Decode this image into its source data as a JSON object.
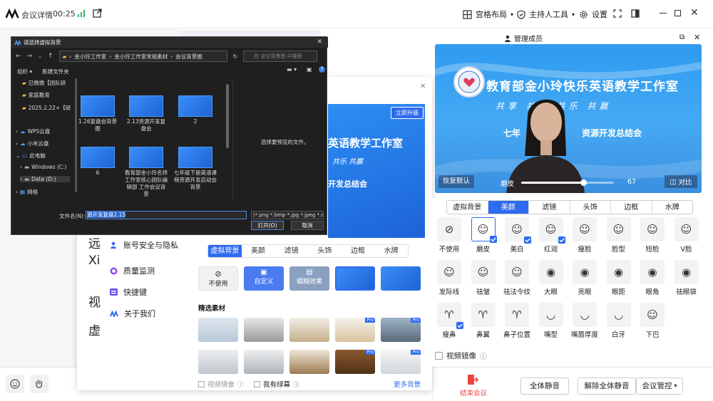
{
  "topbar": {
    "title": "会议详情",
    "timer": "00:25",
    "grid_layout": "宫格布局",
    "host_tools": "主持人工具",
    "settings": "设置"
  },
  "settings_dialog": {
    "nav": [
      {
        "label": "账号安全与隐私"
      },
      {
        "label": "质量监测"
      },
      {
        "label": "快捷键"
      },
      {
        "label": "关于我们"
      }
    ],
    "left_partial": [
      "远",
      "Xi",
      "视",
      "虚"
    ],
    "tabs": [
      "虚拟背景",
      "美颜",
      "滤镜",
      "头饰",
      "边框",
      "水牌"
    ],
    "active_tab": "虚拟背景",
    "options": {
      "none": "不使用",
      "custom": "自定义",
      "blur": "模糊效果"
    },
    "featured_label": "精选素材",
    "pro_badge": "Pro",
    "mirror_label": "视频镜像",
    "greenscreen_label": "我有绿幕",
    "more_bg": "更多背景",
    "preview_upgrade": "立即升级",
    "preview_title": "英语教学工作室",
    "preview_slogan": "共乐 共赢",
    "preview_subtitle": "开发总结会"
  },
  "file_dialog": {
    "title": "请选择虚拟背景",
    "path": [
      "金小玲工作室",
      "金小玲工作室常规素材",
      "会议背景图"
    ],
    "search_placeholder": "在 会议背景图 中搜索",
    "organize": "组织",
    "new_folder": "新建文件夹",
    "sidebar": [
      {
        "label": "已微微【团队研"
      },
      {
        "label": "家庭教育"
      },
      {
        "label": "2025.2.22+【研"
      },
      {
        "label": "WPS云盘"
      },
      {
        "label": "小米云盘"
      },
      {
        "label": "此电脑"
      },
      {
        "label": "Windows (C:)"
      },
      {
        "label": "Data (D:)"
      },
      {
        "label": "网络"
      }
    ],
    "files": [
      {
        "name": "1.26复盘会背景图"
      },
      {
        "name": "2.13资源开发复盘会"
      },
      {
        "name": "2"
      },
      {
        "name": "6"
      },
      {
        "name": "教育部金小玲名师工作室核心团队编辑部 工作会议背景"
      },
      {
        "name": "七年级下册英语课程资源开发启动会背景"
      }
    ],
    "preview_text": "选择要预览的文件。",
    "filename_label": "文件名(N):",
    "filename_value": "源开发复盘2.15",
    "filetype": "(*.png *.bmp *.jpg *.jpeg *.mc",
    "open_btn": "打开(O)",
    "cancel_btn": "取消"
  },
  "video": {
    "banner_title": "教育部金小玲快乐英语教学工作室",
    "slogan": "共享 共育 共乐 共赢",
    "subtitle_left": "七年",
    "subtitle_right": "资源开发总结会",
    "restore_btn": "恢复默认",
    "slider_label": "磨皮",
    "slider_value": "67",
    "slider_level": 0.67,
    "compare_btn": "对比"
  },
  "beauty": {
    "tabs": [
      "虚拟背景",
      "美颜",
      "滤镜",
      "头饰",
      "边框",
      "水牌"
    ],
    "active_tab": "美颜",
    "items": [
      {
        "label": "不使用"
      },
      {
        "label": "磨皮"
      },
      {
        "label": "美白"
      },
      {
        "label": "红润"
      },
      {
        "label": "瘦脸"
      },
      {
        "label": "脸型"
      },
      {
        "label": "短脸"
      },
      {
        "label": "V脸"
      },
      {
        "label": "发际线"
      },
      {
        "label": "祛皱"
      },
      {
        "label": "祛法令纹"
      },
      {
        "label": "大眼"
      },
      {
        "label": "亮眼"
      },
      {
        "label": "眼距"
      },
      {
        "label": "眼角"
      },
      {
        "label": "祛眼袋"
      },
      {
        "label": "瘦鼻"
      },
      {
        "label": "鼻翼"
      },
      {
        "label": "鼻子位置"
      },
      {
        "label": "嘴型"
      },
      {
        "label": "嘴唇厚度"
      },
      {
        "label": "白牙"
      },
      {
        "label": "下巴"
      }
    ],
    "mirror_label": "视频镜像"
  },
  "right_panel": {
    "title": "管理成员"
  },
  "bottombar": {
    "end_meeting": "结束会议",
    "mute_all": "全体静音",
    "unmute_all": "解除全体静音",
    "meeting_control": "会议管控"
  },
  "colors": {
    "accent": "#2f6bf0",
    "danger": "#e8453c",
    "dark_dialog": "#1f1f1f"
  }
}
